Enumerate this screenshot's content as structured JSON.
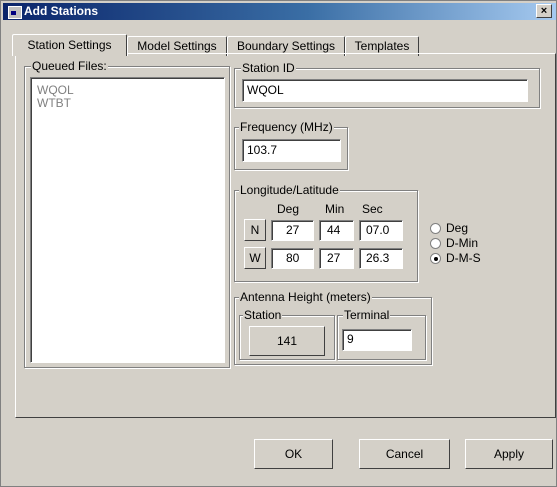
{
  "window": {
    "title": "Add Stations",
    "close_glyph": "×"
  },
  "tabs": [
    "Station Settings",
    "Model Settings",
    "Boundary Settings",
    "Templates"
  ],
  "queued_files": {
    "label": "Queued Files:",
    "items": [
      "WQOL",
      "WTBT"
    ]
  },
  "station_id": {
    "label": "Station ID",
    "value": "WQOL"
  },
  "frequency": {
    "label": "Frequency (MHz)",
    "value": "103.7"
  },
  "coordinates": {
    "label": "Longitude/Latitude",
    "headers": [
      "Deg",
      "Min",
      "Sec"
    ],
    "latitude": {
      "hemisphere": "N",
      "deg": "27",
      "min": "44",
      "sec": "07.0"
    },
    "longitude": {
      "hemisphere": "W",
      "deg": "80",
      "min": "27",
      "sec": "26.3"
    }
  },
  "format_options": {
    "options": [
      "Deg",
      "D-Min",
      "D-M-S"
    ],
    "selected": "D-M-S"
  },
  "antenna": {
    "label": "Antenna Height (meters)",
    "station_label": "Station",
    "station_value": "141",
    "terminal_label": "Terminal",
    "terminal_value": "9"
  },
  "buttons": {
    "ok": "OK",
    "cancel": "Cancel",
    "apply": "Apply"
  }
}
